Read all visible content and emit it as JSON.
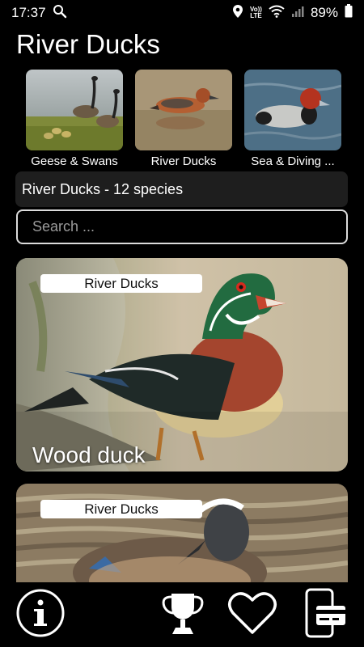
{
  "status_bar": {
    "time": "17:37",
    "lte_line1": "Vo))",
    "lte_line2": "LTE",
    "battery": "89%",
    "icons": [
      "search-icon",
      "location-icon",
      "wifi-icon",
      "signal-icon",
      "battery-icon"
    ]
  },
  "app": {
    "title": "River Ducks"
  },
  "categories": [
    {
      "label": "Geese & Swans",
      "image": "geese-photo"
    },
    {
      "label": "River Ducks",
      "image": "river-duck-photo"
    },
    {
      "label": "Sea & Diving ...",
      "image": "diving-duck-photo"
    }
  ],
  "summary": {
    "text": "River Ducks - 12 species"
  },
  "search": {
    "placeholder": "Search ..."
  },
  "cards": [
    {
      "badge": "River Ducks",
      "name": "Wood duck",
      "image": "wood-duck-photo"
    },
    {
      "badge": "River Ducks",
      "name": "",
      "image": "teal-duck-photo"
    }
  ],
  "bottom_nav": {
    "icons": [
      "info-icon",
      "trophy-icon",
      "heart-icon",
      "payment-icon"
    ]
  },
  "colors": {
    "background": "#000000",
    "surface": "#1e1e1e",
    "search_border": "#dcdcdc",
    "text": "#ffffff"
  }
}
